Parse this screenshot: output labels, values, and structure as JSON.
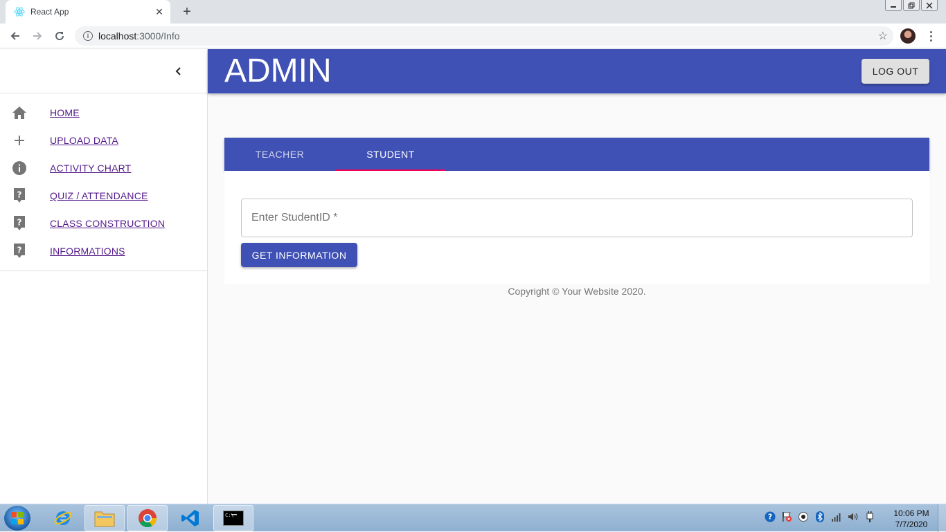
{
  "browser": {
    "tab_title": "React App",
    "new_tab": "+",
    "close_tab": "✕",
    "url_host": "localhost",
    "url_path": ":3000/Info"
  },
  "sidebar": {
    "items": [
      {
        "label": "HOME",
        "icon": "home-icon"
      },
      {
        "label": "UPLOAD DATA",
        "icon": "plus-icon"
      },
      {
        "label": "ACTIVITY CHART",
        "icon": "info-icon"
      },
      {
        "label": "QUIZ / ATTENDANCE",
        "icon": "help-icon"
      },
      {
        "label": "CLASS CONSTRUCTION",
        "icon": "help-icon"
      },
      {
        "label": "INFORMATIONS",
        "icon": "help-icon"
      }
    ]
  },
  "appbar": {
    "title": "ADMIN",
    "logout_label": "LOG OUT"
  },
  "tabs": [
    {
      "label": "TEACHER"
    },
    {
      "label": "STUDENT"
    }
  ],
  "form": {
    "student_id_placeholder": "Enter StudentID *",
    "submit_label": "GET INFORMATION"
  },
  "footer": {
    "copyright": "Copyright © Your Website 2020."
  },
  "taskbar": {
    "time": "10:06 PM",
    "date": "7/7/2020"
  },
  "colors": {
    "primary": "#3f51b5",
    "accent": "#f50057",
    "link": "#551a8b"
  }
}
